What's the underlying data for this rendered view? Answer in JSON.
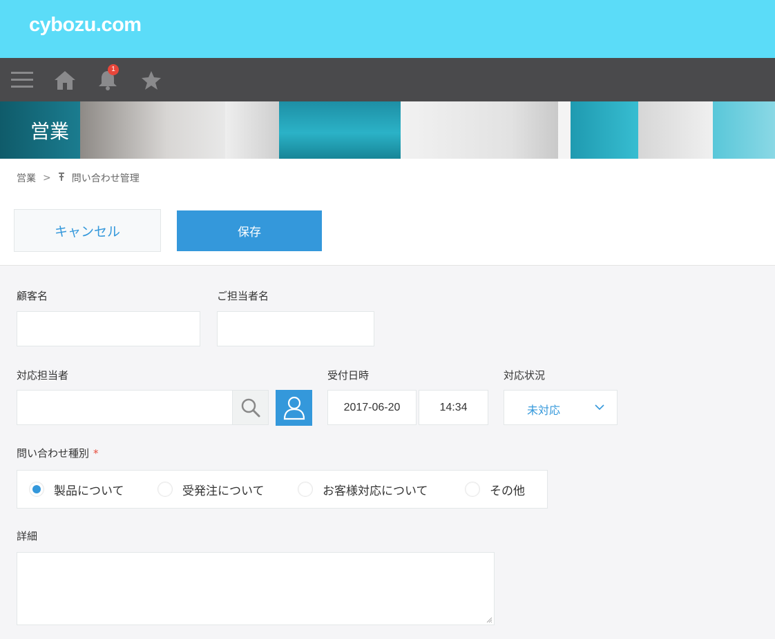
{
  "header": {
    "logo": "cybozu.com"
  },
  "nav": {
    "notification_count": "1"
  },
  "banner": {
    "title": "営業"
  },
  "breadcrumb": {
    "space": "営業",
    "separator": ">",
    "app": "問い合わせ管理"
  },
  "actions": {
    "cancel_label": "キャンセル",
    "save_label": "保存"
  },
  "form": {
    "customer_name": {
      "label": "顧客名",
      "value": ""
    },
    "contact_name": {
      "label": "ご担当者名",
      "value": ""
    },
    "assignee": {
      "label": "対応担当者",
      "value": ""
    },
    "received_at": {
      "label": "受付日時",
      "date": "2017-06-20",
      "time": "14:34"
    },
    "status": {
      "label": "対応状況",
      "value": "未対応"
    },
    "inquiry_type": {
      "label": "問い合わせ種別",
      "required_mark": "*",
      "options": [
        "製品について",
        "受発注について",
        "お客様対応について",
        "その他"
      ],
      "selected": "製品について"
    },
    "details": {
      "label": "詳細",
      "value": ""
    }
  },
  "colors": {
    "header": "#5bdcf8",
    "nav": "#4a4a4c",
    "accent": "#3498db",
    "required": "#e74c3c"
  },
  "icons": [
    "menu-icon",
    "home-icon",
    "bell-icon",
    "star-icon",
    "pin-icon",
    "search-icon",
    "user-icon",
    "chevron-down-icon"
  ]
}
